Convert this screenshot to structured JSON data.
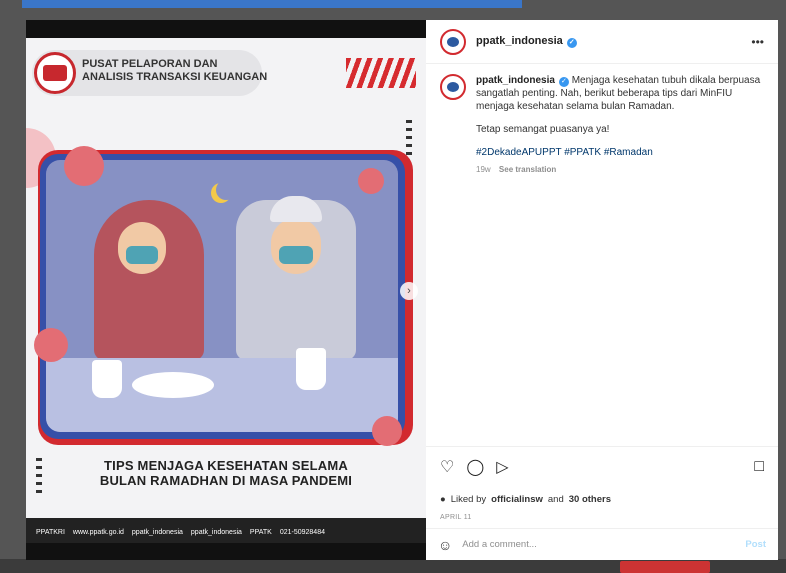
{
  "post": {
    "account": "ppatk_indonesia",
    "more_icon": "•••",
    "caption_text": "Menjaga kesehatan tubuh dikala berpuasa sangatlah penting. Nah, berikut beberapa tips dari MinFIU menjaga kesehatan selama bulan Ramadan.",
    "caption_line2": "Tetap semangat puasanya ya!",
    "hashtags": "#2DekadeAPUPPT #PPATK #Ramadan",
    "age": "19w",
    "see_translation": "See translation",
    "liked_by_prefix": "Liked by",
    "liked_by_user": "officialinsw",
    "liked_by_and": "and",
    "liked_by_others": "30 others",
    "date": "APRIL 11"
  },
  "poster": {
    "org_line1": "PUSAT PELAPORAN DAN",
    "org_line2": "ANALISIS TRANSAKSI KEUANGAN",
    "headline_line1": "TIPS MENJAGA KESEHATAN SELAMA",
    "headline_line2": "BULAN RAMADHAN DI MASA PANDEMI",
    "footer": [
      "PPATKRI",
      "www.ppatk.go.id",
      "ppatk_indonesia",
      "ppatk_indonesia",
      "PPATK",
      "021-50928484"
    ]
  },
  "comment": {
    "placeholder": "Add a comment...",
    "post_label": "Post"
  },
  "icons": {
    "like": "heart-icon",
    "comment": "comment-icon",
    "share": "share-icon",
    "save": "bookmark-icon",
    "emoji": "emoji-icon",
    "next": "chevron-right-icon"
  },
  "colors": {
    "brand_red": "#d22a2f",
    "brand_blue": "#3650a8",
    "verified": "#3897f0",
    "hashtag": "#00376b"
  }
}
